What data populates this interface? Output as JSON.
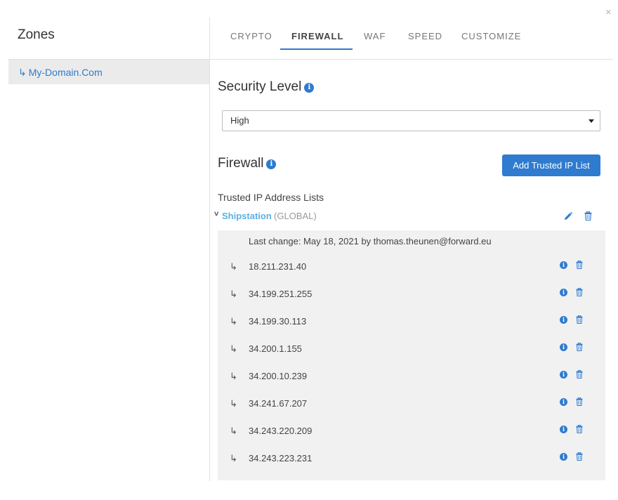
{
  "window": {
    "close_glyph": "×"
  },
  "sidebar": {
    "title": "Zones",
    "items": [
      {
        "arrow": "↳",
        "label": "My-Domain.Com"
      }
    ]
  },
  "tabs": [
    {
      "label": "CRYPTO"
    },
    {
      "label": "FIREWALL",
      "active": true
    },
    {
      "label": "WAF"
    },
    {
      "label": "SPEED"
    },
    {
      "label": "CUSTOMIZE"
    }
  ],
  "security_level": {
    "title": "Security Level",
    "selected": "High"
  },
  "firewall": {
    "title": "Firewall",
    "add_button": "Add Trusted IP List",
    "lists_title": "Trusted IP Address Lists",
    "list": {
      "name": "Shipstation",
      "scope": "(GLOBAL)",
      "last_change": "Last change: May 18, 2021 by thomas.theunen@forward.eu",
      "ips": [
        "18.211.231.40",
        "34.199.251.255",
        "34.199.30.113",
        "34.200.1.155",
        "34.200.10.239",
        "34.241.67.207",
        "34.243.220.209",
        "34.243.223.231"
      ]
    }
  },
  "icons": {
    "info": "info-icon",
    "trash": "trash-icon",
    "edit": "pencil-icon",
    "row_arrow": "↳",
    "chevron": "˅"
  },
  "colors": {
    "accent": "#2e7bcf",
    "list_name": "#5bafe0",
    "panel_bg": "#f1f1f1"
  }
}
